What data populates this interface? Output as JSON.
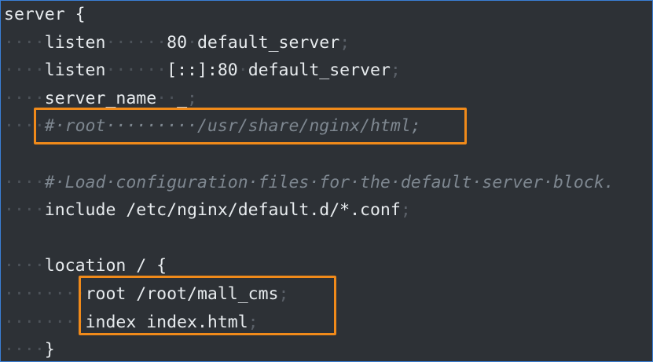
{
  "editor": {
    "lines": [
      {
        "indent": "",
        "code": "server {",
        "semi": "",
        "comment": ""
      },
      {
        "indent": "····",
        "code": "listen······80·default_server",
        "semi": ";",
        "comment": ""
      },
      {
        "indent": "····",
        "code": "listen······[::]:80·default_server",
        "semi": ";",
        "comment": ""
      },
      {
        "indent": "····",
        "code": "server_name··_",
        "semi": ";",
        "comment": ""
      },
      {
        "indent": "····",
        "code": "",
        "semi": "",
        "comment": "#·root·········/usr/share/nginx/html;"
      },
      {
        "indent": "",
        "code": "",
        "semi": "",
        "comment": ""
      },
      {
        "indent": "····",
        "code": "",
        "semi": "",
        "comment": "#·Load·configuration·files·for·the·default·server·block."
      },
      {
        "indent": "····",
        "code": "include /etc/nginx/default.d/*.conf",
        "semi": ";",
        "comment": ""
      },
      {
        "indent": "",
        "code": "",
        "semi": "",
        "comment": ""
      },
      {
        "indent": "····",
        "code": "location / {",
        "semi": "",
        "comment": ""
      },
      {
        "indent": "········",
        "code": "root /root/mall_cms",
        "semi": ";",
        "comment": ""
      },
      {
        "indent": "········",
        "code": "index index.html",
        "semi": ";",
        "comment": ""
      },
      {
        "indent": "····",
        "code": "}",
        "semi": "",
        "comment": ""
      }
    ]
  },
  "colors": {
    "background": "#2d3136",
    "text": "#e7ebee",
    "whitespace_dots": "#4c5259",
    "comment": "#7e8790",
    "highlight_box": "#f08a1a",
    "window_border": "#3a7fd6"
  }
}
